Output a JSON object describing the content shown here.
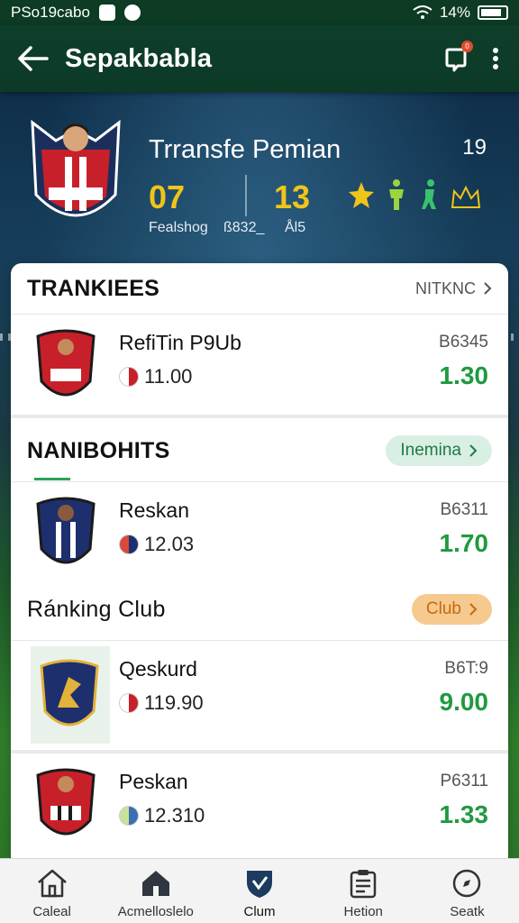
{
  "status_bar": {
    "left_text": "PSo19cabo",
    "battery_text": "14%"
  },
  "app_bar": {
    "title": "Sepakbabla",
    "notification_count": "0"
  },
  "hero": {
    "title": "Trransfe Pemian",
    "count": "19",
    "stat_left": "07",
    "stat_right": "13",
    "sub_left": "Fealshog",
    "sub_mid": "ß832_",
    "sub_right": "Ål5"
  },
  "sections": [
    {
      "title": "TRANKIEES",
      "link": "NITKNC",
      "rows": [
        {
          "name": "RefiTin P9Ub",
          "value": "11.00",
          "code": "B6345",
          "rating": "1.30",
          "badge_colors": [
            "#c8202a",
            "#ffffff"
          ]
        }
      ]
    },
    {
      "title": "NANIBOHITS",
      "pill": "Inemina",
      "rows": [
        {
          "name": "Reskan",
          "value": "12.03",
          "code": "B6311",
          "rating": "1.70",
          "badge_colors": [
            "#1e2f6e",
            "#ffffff"
          ]
        }
      ]
    },
    {
      "title": "Ránking Club",
      "pill": "Club",
      "rows": [
        {
          "name": "Qeskurd",
          "value": "119.90",
          "code": "B6T:9",
          "rating": "9.00",
          "badge_colors": [
            "#1e2f6e",
            "#e2b23a"
          ]
        },
        {
          "name": "Peskan",
          "value": "12.310",
          "code": "P6311",
          "rating": "1.33",
          "badge_colors": [
            "#c8202a",
            "#ffffff"
          ]
        }
      ]
    }
  ],
  "bottom_nav": [
    {
      "label": "Caleal",
      "icon": "home-icon"
    },
    {
      "label": "Acmelloslelo",
      "icon": "house-filled-icon"
    },
    {
      "label": "Clum",
      "icon": "shield-icon"
    },
    {
      "label": "Hetion",
      "icon": "clipboard-icon"
    },
    {
      "label": "Seatk",
      "icon": "compass-icon"
    }
  ],
  "colors": {
    "accent": "#1f9a3f",
    "header": "#0d3b24",
    "gold": "#f0c419"
  }
}
